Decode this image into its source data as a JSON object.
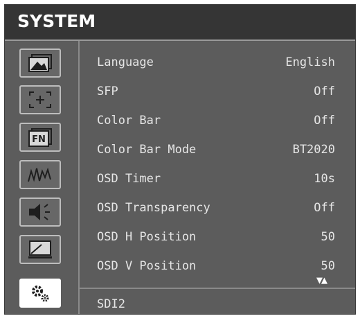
{
  "title": "SYSTEM",
  "sidebar": {
    "items": [
      {
        "icon": "picture-icon"
      },
      {
        "icon": "marker-icon"
      },
      {
        "icon": "function-key-icon"
      },
      {
        "icon": "waveform-icon"
      },
      {
        "icon": "speaker-icon"
      },
      {
        "icon": "display-icon"
      },
      {
        "icon": "system-gear-icon",
        "active": true
      }
    ]
  },
  "menu": {
    "rows": [
      {
        "label": "Language",
        "value": "English"
      },
      {
        "label": "SFP",
        "value": "Off"
      },
      {
        "label": "Color Bar",
        "value": "Off"
      },
      {
        "label": "Color Bar Mode",
        "value": "BT2020"
      },
      {
        "label": "OSD Timer",
        "value": "10s"
      },
      {
        "label": "OSD Transparency",
        "value": "Off"
      },
      {
        "label": "OSD H Position",
        "value": "50"
      },
      {
        "label": "OSD V Position",
        "value": "50"
      }
    ],
    "scroll_indicator": "▼▲"
  },
  "status": {
    "source": "SDI2"
  },
  "colors": {
    "title_bg": "#353535",
    "panel_bg": "#5c5c5c",
    "text": "#e6e6e6",
    "active_tab_bg": "#ffffff"
  },
  "fn_label": "FN"
}
